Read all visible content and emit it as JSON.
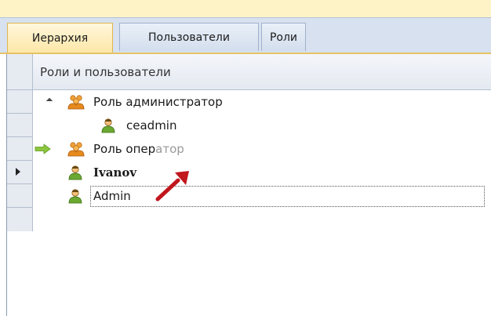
{
  "tabs": [
    {
      "label": "Иерархия",
      "active": true
    },
    {
      "label": "Пользователи",
      "active": false
    },
    {
      "label": "Роли",
      "active": false
    }
  ],
  "grid": {
    "header": "Роли и пользователи",
    "rows": [
      {
        "type": "role",
        "label": "Роль администратор",
        "expanded": true
      },
      {
        "type": "user",
        "label": "ceadmin"
      },
      {
        "type": "role",
        "label_main": "Роль опер",
        "label_faded": "атор",
        "drag_target": true
      },
      {
        "type": "user",
        "label": "Ivanov",
        "selected": true
      },
      {
        "type": "user",
        "label": "Admin"
      }
    ]
  },
  "colors": {
    "accent": "#fde7a8",
    "tab_bg": "#d7e1ef",
    "arrow_green": "#8cc63e",
    "drag_arrow": "#c0161c"
  },
  "icons": {
    "role": "users-group-icon",
    "user": "user-icon",
    "drop_indicator": "green-arrow-icon",
    "drag_cursor": "red-arrow-cursor-icon"
  }
}
